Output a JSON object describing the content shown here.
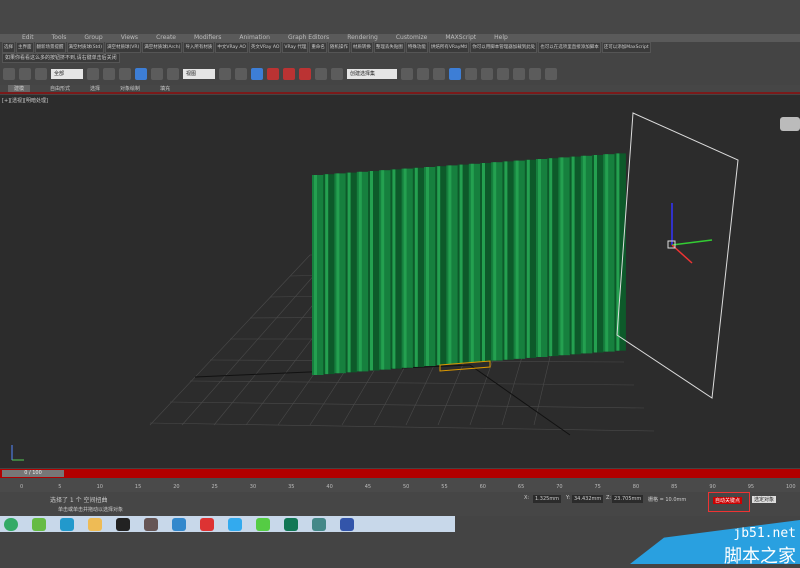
{
  "menu": [
    "Edit",
    "Tools",
    "Group",
    "Views",
    "Create",
    "Modifiers",
    "Animation",
    "Graph Editors",
    "Rendering",
    "Customize",
    "MAXScript",
    "Help"
  ],
  "plugins": [
    "选择",
    "主界面",
    "翻新场景提醒",
    "满空材质球(Std)",
    "满空材质球(VR)",
    "满空材质球(Arch)",
    "导入所有材质",
    "中文VRay AO",
    "英文VRay AO",
    "VRay 代理",
    "重命名",
    "随机操作",
    "材质转换",
    "整理丢失贴图",
    "特殊功能",
    "烘焙所有VRayMtl",
    "你可以用脚本管理器加载到此处",
    "也可以在选项里直接添加脚本",
    "还可以添加MaxScript"
  ],
  "hint": "如果你看看这么多的按钮挤不到,请右键单击后关闭",
  "toolbar": {
    "filter": "全部",
    "refcoord": "视图",
    "selset": "创建选择集"
  },
  "ribbon": [
    "建模",
    "自由形式",
    "选择",
    "对象绘制",
    "填充"
  ],
  "viewport_label": "[+][透视][明暗处理]",
  "timeline": {
    "position": "0 / 100",
    "ticks": [
      "0",
      "5",
      "10",
      "15",
      "20",
      "25",
      "30",
      "35",
      "40",
      "45",
      "50",
      "55",
      "60",
      "65",
      "70",
      "75",
      "80",
      "85",
      "90",
      "95",
      "100"
    ]
  },
  "status": {
    "message": "选择了 1 个 空间扭曲",
    "prompt": "单击或单击并拖动以选择对象",
    "x": "1.325mm",
    "y": "34.432mm",
    "z": "23.705mm",
    "grid": "栅格 = 10.0mm",
    "autokey": "自动关键点",
    "selected": "选定对象"
  },
  "watermark": {
    "site": "jb51.net",
    "name": "脚本之家"
  }
}
